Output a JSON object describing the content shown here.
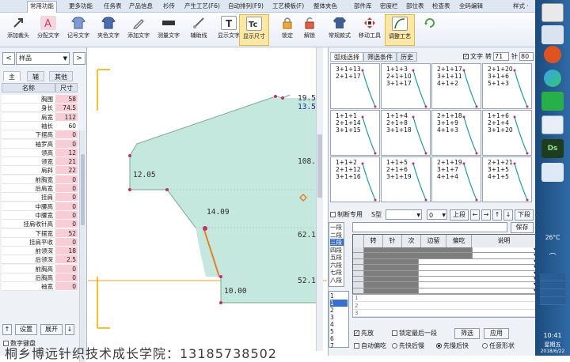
{
  "menubar": {
    "items": [
      "常用功能",
      "更多功能",
      "任务表",
      "产品信息",
      "衫传",
      "产生工艺(F6)",
      "自动排列(F9)",
      "工艺模板(F)",
      "整体夹色",
      "部件库",
      "密度栏",
      "部位表",
      "检查表",
      "全码编辑"
    ],
    "right": "样式 ·"
  },
  "ribbon": {
    "tools": [
      {
        "label": "添加裁头",
        "icon": "arrow-icon",
        "color": "#555"
      },
      {
        "label": "分配文字",
        "icon": "text-a-icon",
        "color": "#c7406b"
      },
      {
        "label": "记号文字",
        "icon": "shirt-icon",
        "color": "#5779b5"
      },
      {
        "label": "夹色文字",
        "icon": "shirt-icon",
        "color": "#4b6db0"
      },
      {
        "label": "添加文字",
        "icon": "pencil-icon",
        "color": "#666"
      },
      {
        "label": "测量文字",
        "icon": "ruler-icon",
        "color": "#444"
      },
      {
        "label": "辅助线",
        "icon": "pen-icon",
        "color": "#666"
      },
      {
        "label": "显示文字",
        "icon": "t-icon",
        "color": "#333"
      },
      {
        "label": "显示尺寸",
        "icon": "tc-icon",
        "color": "#333"
      },
      {
        "label": "锁定",
        "icon": "lock-icon",
        "color": "#e08a1e"
      },
      {
        "label": "解锁",
        "icon": "unlock-icon",
        "color": "#d34b2a"
      },
      {
        "label": "常规款式",
        "icon": "sweater-icon",
        "color": "#3b5f92"
      },
      {
        "label": "移动工具",
        "icon": "move-icon",
        "color": "#d7342a"
      },
      {
        "label": "调整工艺",
        "icon": "curve-icon",
        "color": "#2a6d2a"
      },
      {
        "label": "",
        "icon": "refresh-icon",
        "color": "#55a04a"
      }
    ]
  },
  "left": {
    "prev": "<",
    "next": ">",
    "sample": "样品",
    "tabs": [
      "主",
      "辅",
      "其他"
    ],
    "header": {
      "name": "名称",
      "size": "尺寸"
    },
    "rows": [
      {
        "name": "胸围",
        "value": "58"
      },
      {
        "name": "身长",
        "value": "74.5"
      },
      {
        "name": "肩宽",
        "value": "112"
      },
      {
        "name": "袖长",
        "value": "60"
      },
      {
        "name": "下摆高",
        "value": "0"
      },
      {
        "name": "袖罗高",
        "value": "0"
      },
      {
        "name": "领高",
        "value": "12"
      },
      {
        "name": "领宽",
        "value": "21"
      },
      {
        "name": "肩斜",
        "value": "22"
      },
      {
        "name": "前胸宽",
        "value": "0"
      },
      {
        "name": "后肩宽",
        "value": "0"
      },
      {
        "name": "挂肩",
        "value": "0"
      },
      {
        "name": "中腰高",
        "value": "0"
      },
      {
        "name": "中腰宽",
        "value": "0"
      },
      {
        "name": "挂肩收针高",
        "value": "0"
      },
      {
        "name": "下摆宽",
        "value": "52"
      },
      {
        "name": "挂肩平收",
        "value": "0"
      },
      {
        "name": "前领深",
        "value": "18"
      },
      {
        "name": "后领深",
        "value": "2.5"
      },
      {
        "name": "前胸高",
        "value": "0"
      },
      {
        "name": "后胸高",
        "value": "0"
      },
      {
        "name": "袖宽",
        "value": "0"
      }
    ],
    "up_btn": "↑",
    "set_btn": "设置",
    "expand_btn": "展开",
    "down_btn": "↓",
    "keyboard": "数字键盘"
  },
  "canvas": {
    "labels": [
      "19.5",
      "13.5",
      "108.",
      "12.05",
      "14.09",
      "62.1",
      "52.1",
      "10.00"
    ]
  },
  "right": {
    "tabs": [
      "弧线选择",
      "筛选条件",
      "历史"
    ],
    "text_cb": "文字",
    "needle_label": "转",
    "needle_val": "71",
    "stitch_label": "针",
    "stitch_val": "80",
    "cells": [
      [
        "3+1+13",
        "2+1+17"
      ],
      [
        "1+1+3",
        "2+1+10",
        "3+1+17"
      ],
      [
        "2+1+17",
        "3+1+11",
        "4+1+2"
      ],
      [
        "2+1+20",
        "3+1+6",
        "5+1+3"
      ],
      [
        "1+1+1",
        "2+1+14",
        "3+1+15"
      ],
      [
        "1+1+4",
        "2+1+8",
        "3+1+18"
      ],
      [
        "2+1+18",
        "3+1+9",
        "4+1+3"
      ],
      [
        "1+1+6",
        "2+1+4",
        "3+1+20"
      ],
      [
        "1+1+2",
        "2+1+12",
        "3+1+16"
      ],
      [
        "1+1+5",
        "2+1+6",
        "3+1+19"
      ],
      [
        "2+1+19",
        "3+1+7",
        "4+1+4"
      ],
      [
        "2+1+21",
        "3+1+5",
        "4+1+5"
      ]
    ],
    "special_cb": "制断专用",
    "s_type": "S型",
    "num_val": "0",
    "up_seg": "上段",
    "down_seg": "下段",
    "save_btn": "保存",
    "segments": [
      "一段",
      "二段",
      "三段",
      "四段",
      "五段",
      "六段",
      "七段",
      "八段"
    ],
    "grid_headers": [
      "转",
      "针",
      "次",
      "边留",
      "偏吃",
      "说明"
    ],
    "grid_rows": [
      "",
      "",
      "",
      "",
      "",
      "",
      "",
      "",
      "",
      "",
      ""
    ],
    "list_nums": [
      "1",
      "1",
      "2",
      "3",
      "4",
      "5",
      "6",
      "7"
    ],
    "bottom_rows": [
      "1",
      "2",
      "3"
    ],
    "first_cb": "先放",
    "lock_last": "锁定最后一段",
    "filter_btn": "筛选",
    "apply_btn": "应用",
    "auto_cb": "自动偏吃",
    "radio1": "先快后慢",
    "radio2": "先慢后快",
    "radio3": "任意形状"
  },
  "taskbar": {
    "temp": "26°C",
    "time": "10:41",
    "weekday": "星期五",
    "date": "2018/6/22"
  },
  "watermark": "桐乡博远针织技术成长学院：13185738502"
}
